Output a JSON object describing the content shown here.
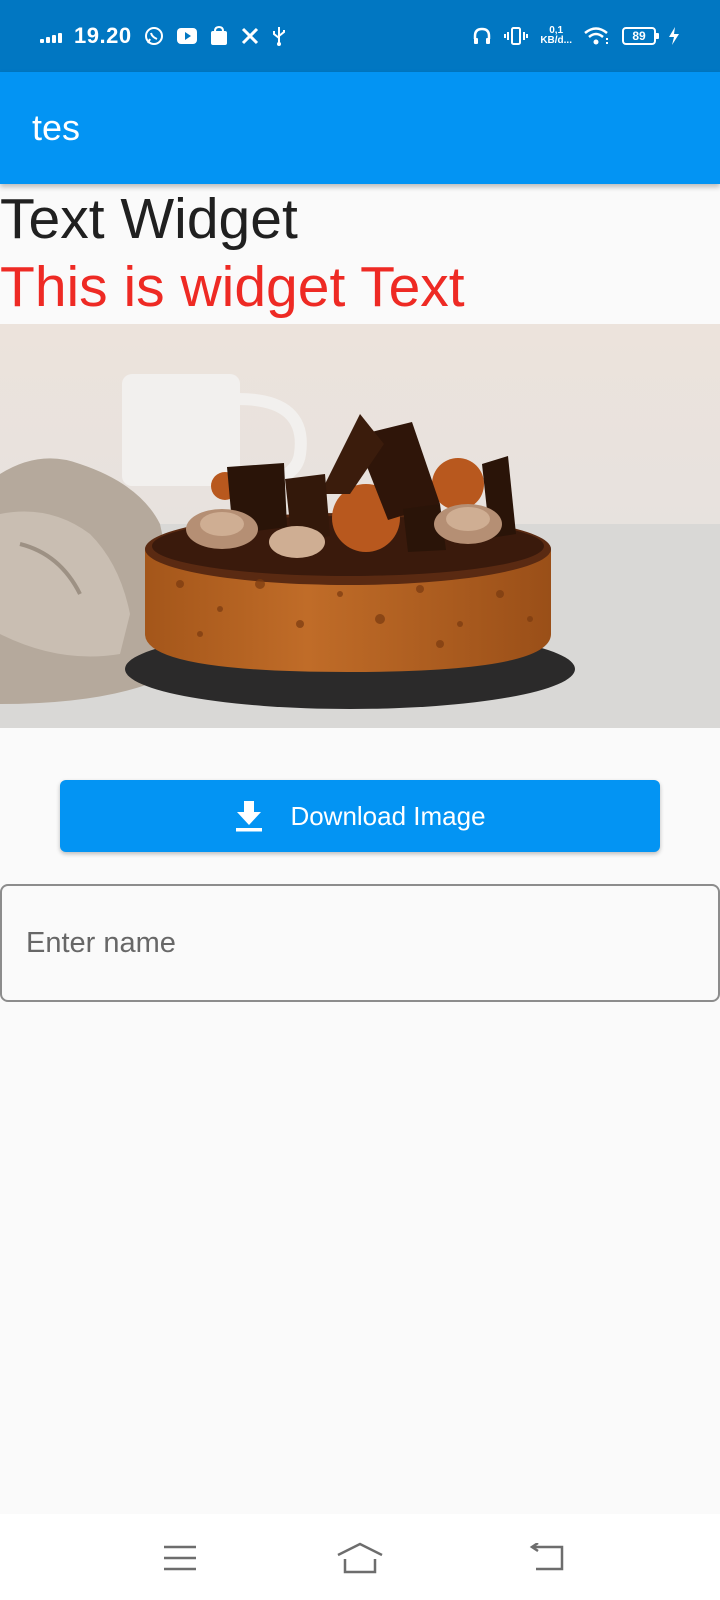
{
  "status_bar": {
    "time": "19.20",
    "speed_value": "0,1",
    "speed_unit": "KB/d...",
    "battery": "89",
    "icons": [
      "signal-icon",
      "whatsapp-icon",
      "youtube-icon",
      "shopping-bag-icon",
      "tools-icon",
      "usb-icon",
      "headphones-icon",
      "vibrate-icon",
      "wifi-icon",
      "battery-icon",
      "charging-icon"
    ]
  },
  "app_bar": {
    "title": "tes"
  },
  "content": {
    "heading": "Text Widget",
    "subheading": "This is widget Text",
    "image": "chocolate-cake-image"
  },
  "button": {
    "label": "Download Image",
    "icon": "download-icon"
  },
  "name_input": {
    "placeholder": "Enter name",
    "value": ""
  },
  "nav_bar": {
    "items": [
      "menu-icon",
      "home-icon",
      "back-icon"
    ]
  },
  "colors": {
    "status_bar": "#0177c2",
    "app_bar": "#0394f3",
    "heading": "#202020",
    "subheading": "#ee2a24",
    "button": "#0394f3",
    "background": "#fafafa"
  }
}
